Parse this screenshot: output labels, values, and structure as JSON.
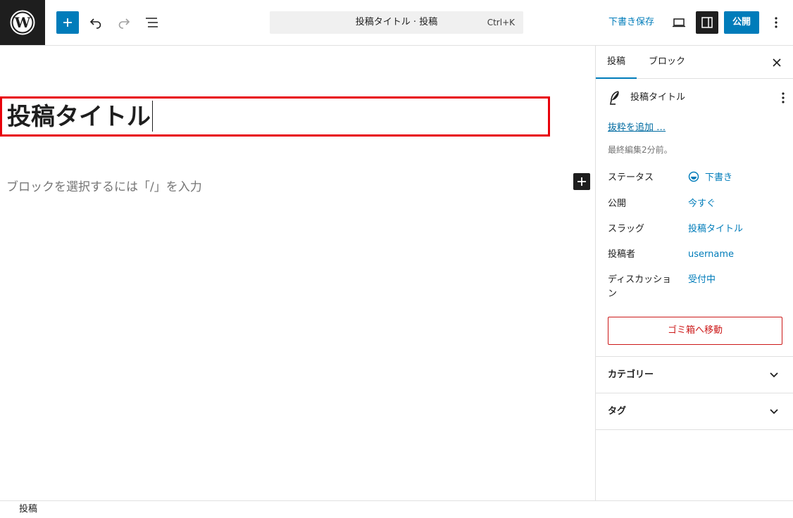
{
  "header": {
    "command_title": "投稿タイトル · 投稿",
    "command_shortcut": "Ctrl+K",
    "save_draft": "下書き保存",
    "publish": "公開"
  },
  "editor": {
    "post_title": "投稿タイトル",
    "block_placeholder": "ブロックを選択するには「/」を入力"
  },
  "sidebar": {
    "tabs": [
      {
        "label": "投稿",
        "active": true
      },
      {
        "label": "ブロック",
        "active": false
      }
    ],
    "summary_title": "投稿タイトル",
    "excerpt_link": "抜粋を追加 …",
    "last_edited": "最終編集2分前。",
    "rows": [
      {
        "label": "ステータス",
        "value": "下書き"
      },
      {
        "label": "公開",
        "value": "今すぐ"
      },
      {
        "label": "スラッグ",
        "value": "投稿タイトル"
      },
      {
        "label": "投稿者",
        "value": "username"
      },
      {
        "label": "ディスカッション",
        "value": "受付中"
      }
    ],
    "trash_button": "ゴミ箱へ移動",
    "panels": [
      {
        "title": "カテゴリー"
      },
      {
        "title": "タグ"
      }
    ]
  },
  "footer": {
    "breadcrumb": "投稿"
  },
  "colors": {
    "accent": "#007cba",
    "danger": "#cc1818",
    "highlight_border": "#e8000b",
    "dark": "#1e1e1e"
  }
}
